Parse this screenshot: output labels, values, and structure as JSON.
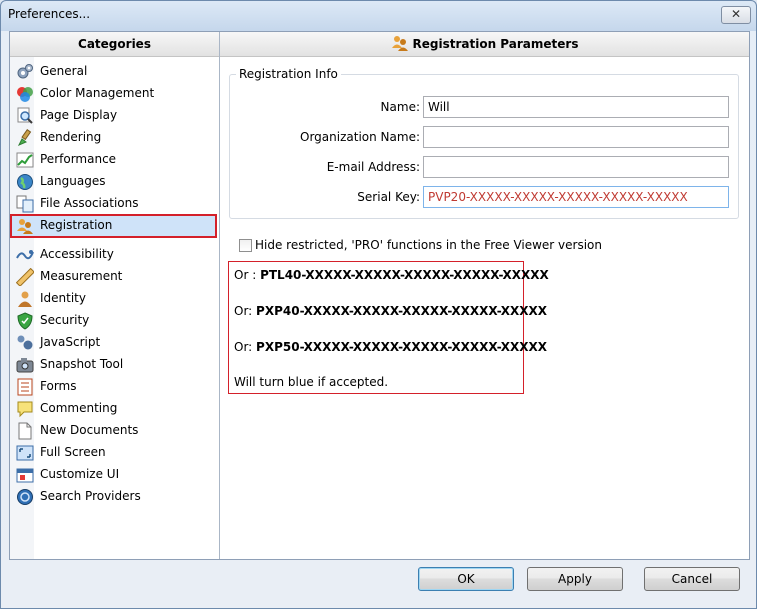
{
  "window": {
    "title": "Preferences...",
    "close_symbol": "✕"
  },
  "left_pane": {
    "header": "Categories",
    "items": [
      {
        "label": "General",
        "icon": "gears-icon"
      },
      {
        "label": "Color Management",
        "icon": "color-circles-icon"
      },
      {
        "label": "Page Display",
        "icon": "magnifier-page-icon"
      },
      {
        "label": "Rendering",
        "icon": "paint-brush-icon"
      },
      {
        "label": "Performance",
        "icon": "chart-icon"
      },
      {
        "label": "Languages",
        "icon": "globe-icon"
      },
      {
        "label": "File Associations",
        "icon": "file-associations-icon"
      },
      {
        "label": "Registration",
        "icon": "registration-users-icon",
        "selected": true
      },
      {
        "label": "Accessibility",
        "icon": "accessibility-icon"
      },
      {
        "label": "Measurement",
        "icon": "ruler-icon"
      },
      {
        "label": "Identity",
        "icon": "person-icon"
      },
      {
        "label": "Security",
        "icon": "shield-icon"
      },
      {
        "label": "JavaScript",
        "icon": "javascript-icon"
      },
      {
        "label": "Snapshot Tool",
        "icon": "camera-icon"
      },
      {
        "label": "Forms",
        "icon": "form-icon"
      },
      {
        "label": "Commenting",
        "icon": "comment-icon"
      },
      {
        "label": "New Documents",
        "icon": "new-document-icon"
      },
      {
        "label": "Full Screen",
        "icon": "full-screen-icon"
      },
      {
        "label": "Customize UI",
        "icon": "customize-ui-icon"
      },
      {
        "label": "Search Providers",
        "icon": "search-globe-icon"
      }
    ]
  },
  "right_pane": {
    "header": "Registration Parameters",
    "group_title": "Registration Info",
    "fields": {
      "name_label": "Name:",
      "name_value": "Will",
      "org_label": "Organization Name:",
      "org_value": "",
      "email_label": "E-mail Address:",
      "email_value": "",
      "serial_label": "Serial Key:",
      "serial_value": "PVP20-XXXXX-XXXXX-XXXXX-XXXXX-XXXXX"
    },
    "hide_checkbox_label": "Hide restricted, 'PRO' functions in the Free Viewer version",
    "hide_checkbox_checked": false,
    "note": {
      "line1_prefix": "Or : ",
      "line1_key": "PTL40-XXXXX-XXXXX-XXXXX-XXXXX-XXXXX",
      "line2_prefix": "Or: ",
      "line2_key": "PXP40-XXXXX-XXXXX-XXXXX-XXXXX-XXXXX",
      "line3_prefix": "Or: ",
      "line3_key": "PXP50-XXXXX-XXXXX-XXXXX-XXXXX-XXXXX",
      "line4": "Will turn blue if accepted."
    }
  },
  "buttons": {
    "ok": "OK",
    "apply": "Apply",
    "cancel": "Cancel"
  },
  "colors": {
    "serial_text": "#c03a32",
    "highlight_border": "#d4202a",
    "selection_bg": "#cfe3f9"
  }
}
